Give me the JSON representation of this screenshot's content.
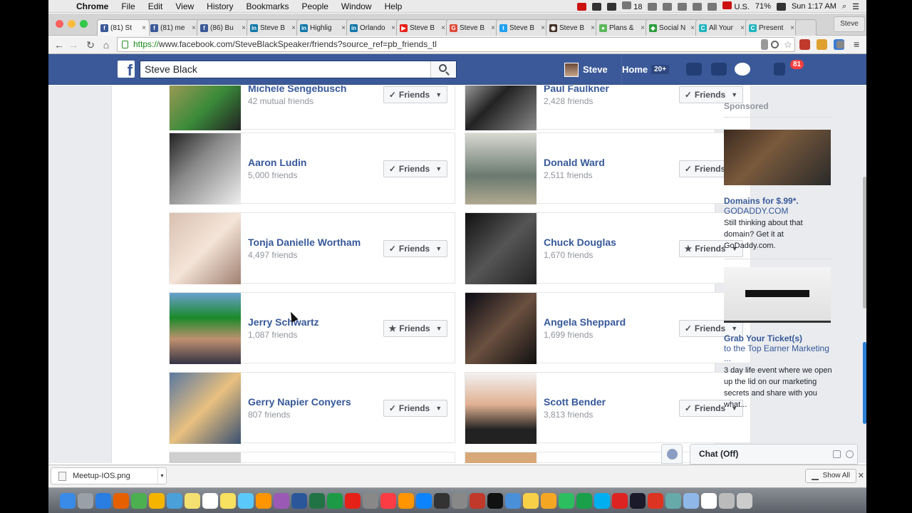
{
  "menubar": {
    "app": "Chrome",
    "items": [
      "File",
      "Edit",
      "View",
      "History",
      "Bookmarks",
      "People",
      "Window",
      "Help"
    ],
    "status": {
      "count": "18",
      "locale": "U.S.",
      "battery": "71%",
      "clock": "Sun 1:17 AM"
    }
  },
  "tabs": [
    {
      "title": "(81) St",
      "color": "#3b5998",
      "glyph": "f"
    },
    {
      "title": "(81) me",
      "color": "#3b5998",
      "glyph": "f"
    },
    {
      "title": "(86) Bu",
      "color": "#3b5998",
      "glyph": "f"
    },
    {
      "title": "Steve B",
      "color": "#0e76a8",
      "glyph": "in"
    },
    {
      "title": "Highlig",
      "color": "#0e76a8",
      "glyph": "in"
    },
    {
      "title": "Orlando",
      "color": "#0e76a8",
      "glyph": "in"
    },
    {
      "title": "Steve B",
      "color": "#e62117",
      "glyph": "▶"
    },
    {
      "title": "Steve B",
      "color": "#dd4b39",
      "glyph": "G"
    },
    {
      "title": "Steve B",
      "color": "#1da1f2",
      "glyph": "t"
    },
    {
      "title": "Steve B",
      "color": "#3f2d24",
      "glyph": "◉"
    },
    {
      "title": "Plans &",
      "color": "#5cb85c",
      "glyph": "●"
    },
    {
      "title": "Social N",
      "color": "#2a9d3c",
      "glyph": "◆"
    },
    {
      "title": "All Your",
      "color": "#22b5bf",
      "glyph": "C"
    },
    {
      "title": "Present",
      "color": "#22b5bf",
      "glyph": "C"
    }
  ],
  "profile_name": "Steve",
  "url": {
    "scheme": "https://",
    "rest": "www.facebook.com/SteveBlackSpeaker/friends?source_ref=pb_friends_tl"
  },
  "fb": {
    "search_value": "Steve Black",
    "user_name": "Steve",
    "home_label": "Home",
    "home_count": "20+",
    "notif_count": "81"
  },
  "friends": [
    {
      "name": "Michele Sengebusch",
      "count": "42 mutual friends",
      "button": "Friends",
      "mark": "✓"
    },
    {
      "name": "Paul Faulkner",
      "count": "2,428 friends",
      "button": "Friends",
      "mark": "✓"
    },
    {
      "name": "Aaron Ludin",
      "count": "5,000 friends",
      "button": "Friends",
      "mark": "✓"
    },
    {
      "name": "Donald Ward",
      "count": "2,511 friends",
      "button": "Friends",
      "mark": "✓"
    },
    {
      "name": "Tonja Danielle Wortham",
      "count": "4,497 friends",
      "button": "Friends",
      "mark": "✓"
    },
    {
      "name": "Chuck Douglas",
      "count": "1,670 friends",
      "button": "Friends",
      "mark": "★"
    },
    {
      "name": "Jerry Schwartz",
      "count": "1,087 friends",
      "button": "Friends",
      "mark": "★"
    },
    {
      "name": "Angela Sheppard",
      "count": "1,699 friends",
      "button": "Friends",
      "mark": "✓"
    },
    {
      "name": "Gerry Napier Conyers",
      "count": "807 friends",
      "button": "Friends",
      "mark": "✓"
    },
    {
      "name": "Scott Bender",
      "count": "3,813 friends",
      "button": "Friends",
      "mark": "✓"
    }
  ],
  "ads": {
    "title": "Sponsored",
    "items": [
      {
        "headline": "Domains for $.99*.",
        "source": "GODADDY.COM",
        "body": "Still thinking about that domain? Get it at GoDaddy.com."
      },
      {
        "headline": "Grab Your Ticket(s)",
        "source": "to the Top Earner Marketing ...",
        "body": "3 day life event where we open up the lid on our marketing secrets and share with you what..."
      }
    ]
  },
  "chat": {
    "label": "Chat (Off)"
  },
  "downloads": {
    "file": "Meetup-IOS.png",
    "show_all": "Show All"
  }
}
